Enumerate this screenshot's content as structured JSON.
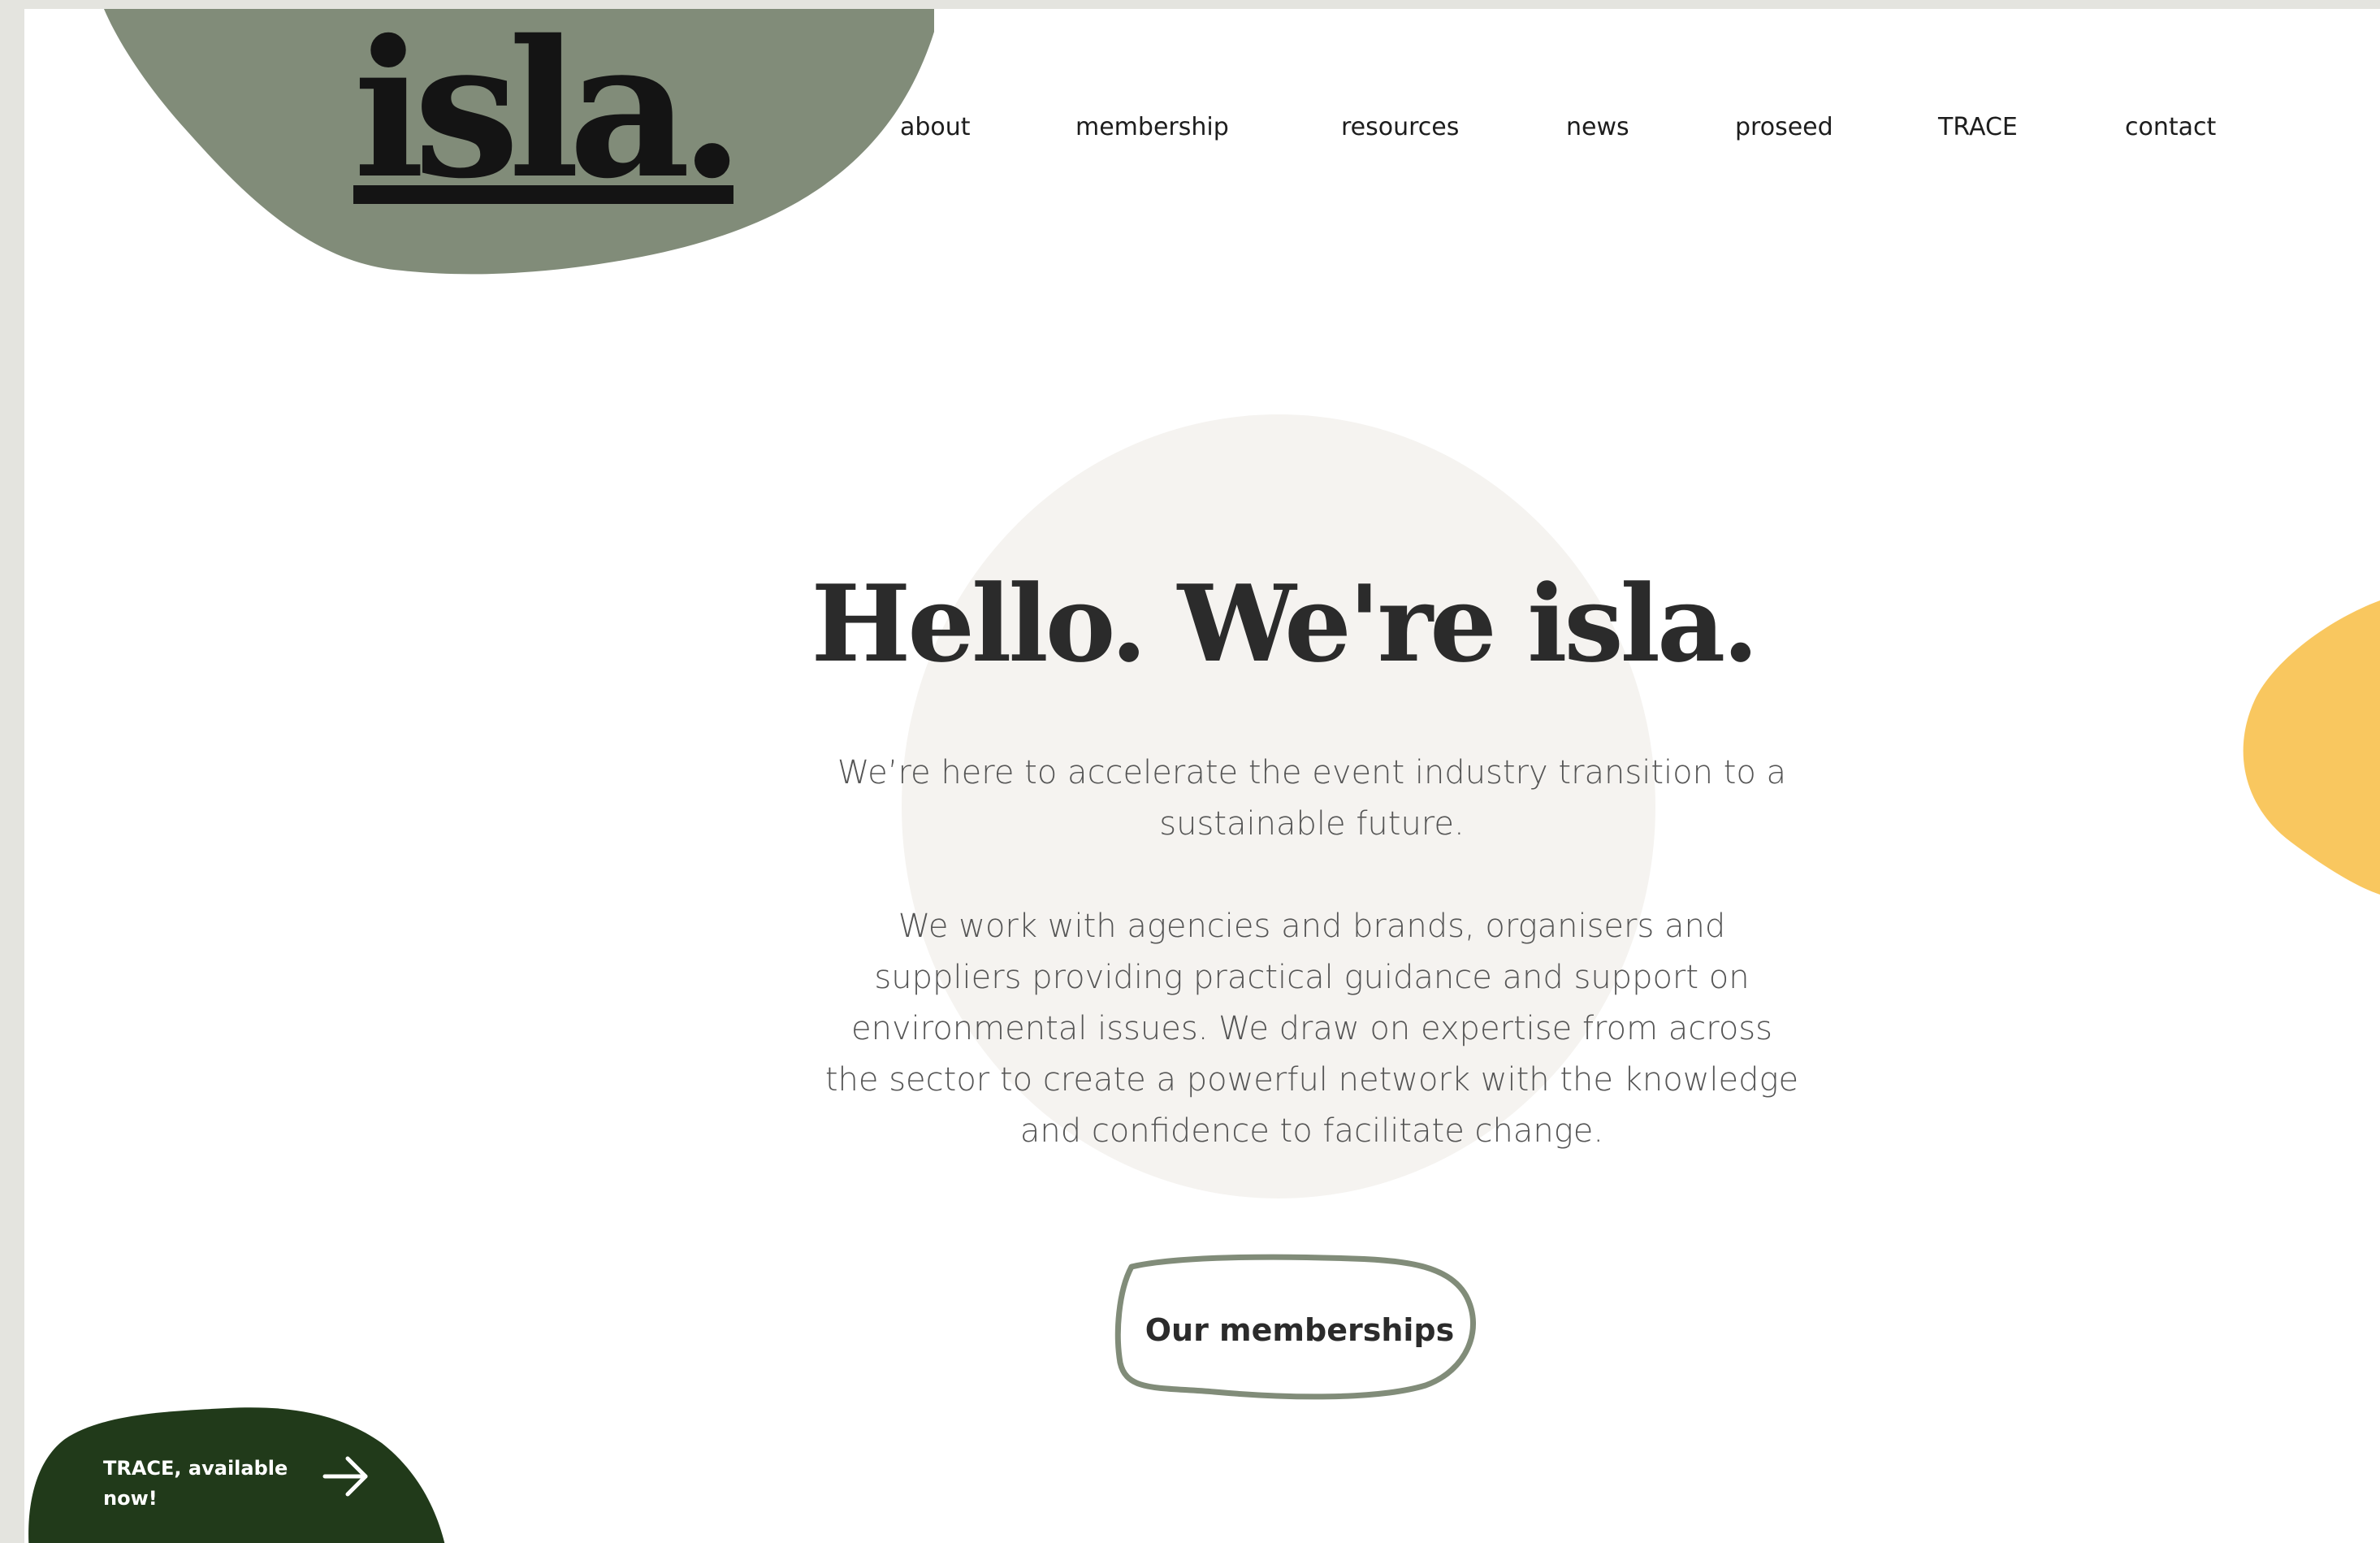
{
  "brand": {
    "logo_text": "isla.",
    "colors": {
      "sage": "#818c79",
      "forest": "#213a1a",
      "mustard": "#f9c75f",
      "cream": "#f5f3f0",
      "ink": "#2b2b2b"
    }
  },
  "nav": {
    "items": [
      {
        "label": "about"
      },
      {
        "label": "membership"
      },
      {
        "label": "resources"
      },
      {
        "label": "news"
      },
      {
        "label": "proseed"
      },
      {
        "label": "TRACE"
      },
      {
        "label": "contact"
      }
    ]
  },
  "hero": {
    "headline": "Hello. We're isla.",
    "intro": "We’re here to accelerate the event industry transition to a sustainable future.",
    "body": "We work with agencies and brands, organisers and suppliers providing practical guidance and support on environmental issues. We draw on expertise from across the sector to create a powerful network with the knowledge and confidence to facilitate change.",
    "cta_label": "Our memberships"
  },
  "trace_badge": {
    "text": "TRACE, available now!",
    "icon": "arrow-right-icon"
  }
}
